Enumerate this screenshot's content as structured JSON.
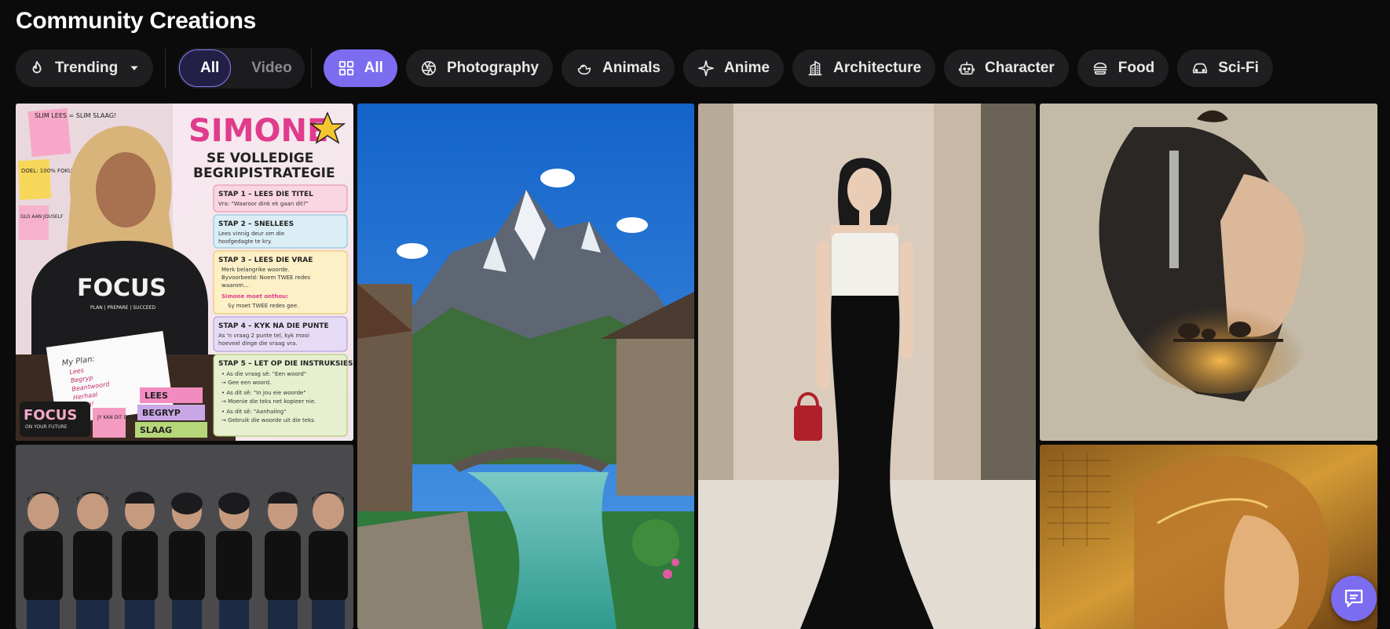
{
  "page": {
    "title": "Community Creations"
  },
  "filters": {
    "sort": {
      "label": "Trending",
      "icon": "flame-icon"
    },
    "media_type": {
      "options": [
        "All",
        "Video"
      ],
      "selected": "All"
    },
    "categories": [
      {
        "label": "All",
        "icon": "grid-icon",
        "active": true
      },
      {
        "label": "Photography",
        "icon": "aperture-icon",
        "active": false
      },
      {
        "label": "Animals",
        "icon": "duck-icon",
        "active": false
      },
      {
        "label": "Anime",
        "icon": "sparkle-icon",
        "active": false
      },
      {
        "label": "Architecture",
        "icon": "building-icon",
        "active": false
      },
      {
        "label": "Character",
        "icon": "robot-icon",
        "active": false
      },
      {
        "label": "Food",
        "icon": "burger-icon",
        "active": false
      },
      {
        "label": "Sci-Fi",
        "icon": "car-icon",
        "active": false
      }
    ]
  },
  "poster": {
    "name": "SIMONE",
    "subtitle_1": "SE VOLLEDIGE",
    "subtitle_2": "BEGRIPISTRATEGIE",
    "note_1": "SLIM LEES = SLIM SLAAG!",
    "note_2": "DOEL: 100% FOKUS",
    "note_3": "GLO AAN JOUSELF",
    "shirt": "FOCUS",
    "shirt_sub": "PLAN | PREPARE | SUCCEED",
    "plan_title": "My Plan:",
    "plan_items": [
      "Lees",
      "Begryp",
      "Beantwoord",
      "Herhaal",
      "Slaag!"
    ],
    "pencil_case": "FOCUS",
    "pencil_case_sub": "ON YOUR FUTURE",
    "books": [
      "LEES",
      "BEGRYP",
      "SLAAG"
    ],
    "note_4": "JY KAN DIT DOEN!",
    "steps": [
      {
        "title": "STAP 1 – LEES DIE TITEL",
        "body": [
          "Vra: \"Waaroor dink ek gaan dit?\""
        ]
      },
      {
        "title": "STAP 2 – SNELLEES",
        "body": [
          "Lees vinnig deur om die",
          "hoofgedagte te kry."
        ]
      },
      {
        "title": "STAP 3 – LEES DIE VRAE",
        "body": [
          "Merk belangrike woorde.",
          "Byvoorbeeld: Noem TWEE redes",
          "waarom..."
        ],
        "remember_label": "Simone moet onthou:",
        "remember_text": "Sy moet TWEE redes gee."
      },
      {
        "title": "STAP 4 – KYK NA DIE PUNTE",
        "body": [
          "As 'n vraag 2 punte tel, kyk mooi",
          "hoeveel dinge die vraag vra."
        ]
      },
      {
        "title": "STAP 5 – LET OP DIE INSTRUKSIES",
        "body": [
          "• As die vraag sê: \"Een woord\"",
          "  → Gee een woord.",
          "• As dit sê: \"In jou eie woorde\"",
          "  → Moenie die teks net kopieer nie.",
          "• As dit sê: \"Aanhaling\"",
          "  → Gebruik die woorde uit die teks."
        ]
      }
    ]
  },
  "colors": {
    "accent": "#7b6cf0",
    "background": "#0b0b0c",
    "pill": "#1f1f22"
  }
}
